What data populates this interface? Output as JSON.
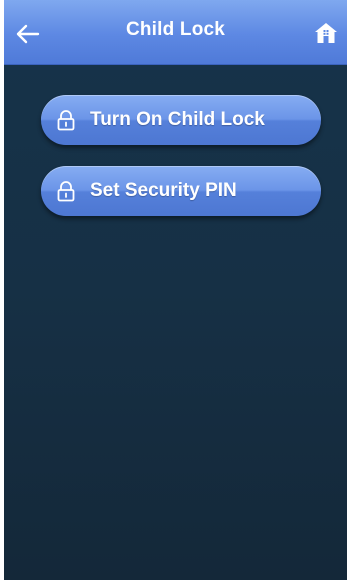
{
  "header": {
    "title": "Child Lock",
    "back_icon": "arrow-left-icon",
    "home_icon": "home-icon"
  },
  "menu": {
    "items": [
      {
        "label": "Turn On Child Lock",
        "icon": "lock-icon"
      },
      {
        "label": "Set Security PIN",
        "icon": "lock-icon"
      }
    ]
  },
  "colors": {
    "header": "#5d88e3",
    "background": "#16334a",
    "button": "#6b95e8",
    "text": "#ffffff"
  }
}
